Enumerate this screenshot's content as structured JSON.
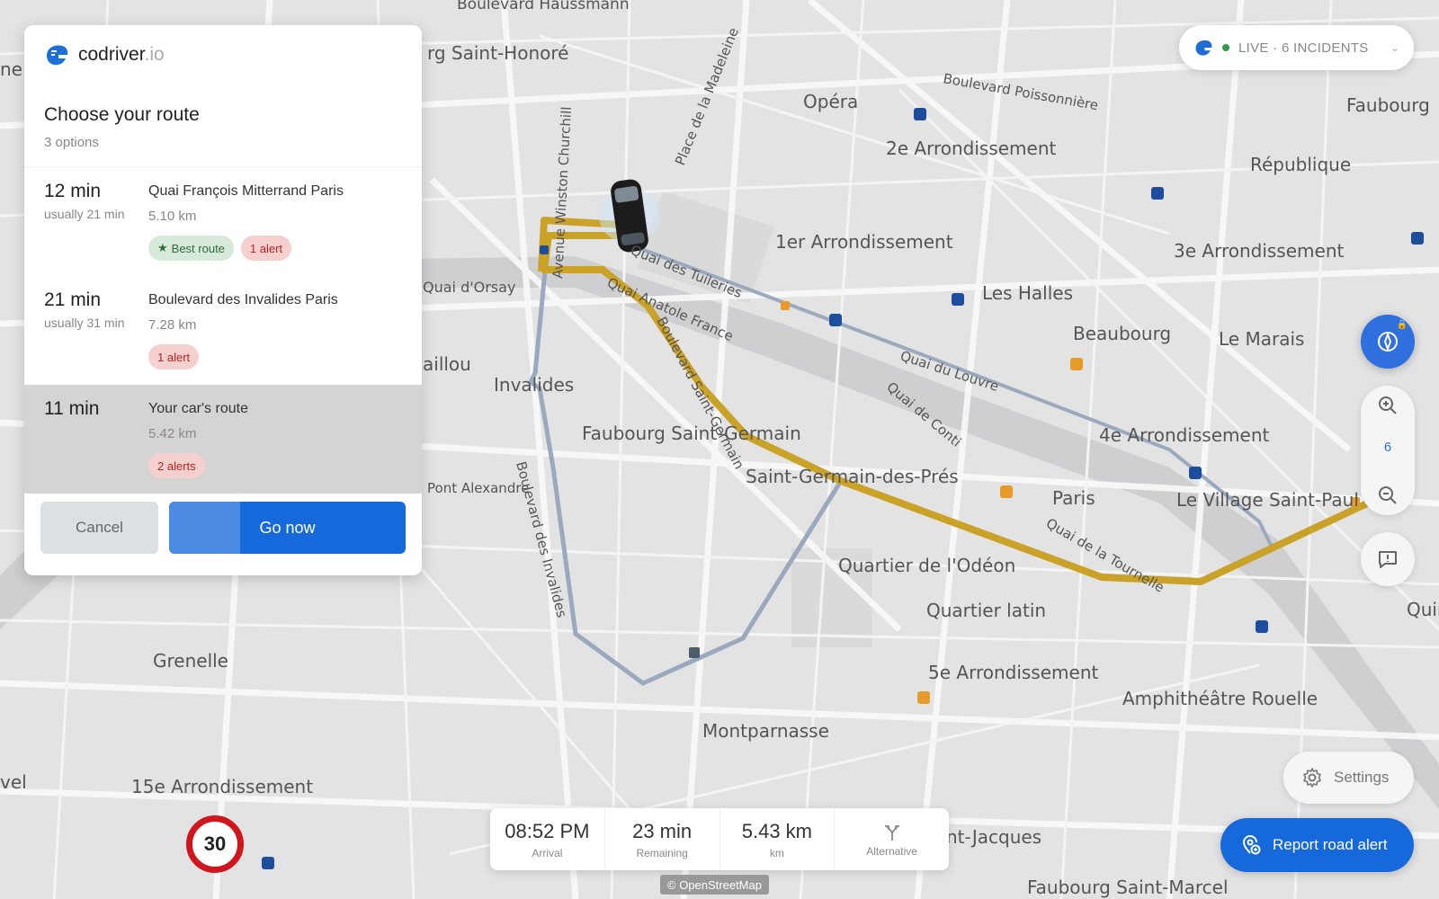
{
  "brand": {
    "name": "codriver",
    "tld": ".io"
  },
  "panel": {
    "title": "Choose your route",
    "subtitle": "3 options",
    "routes": [
      {
        "time": "12 min",
        "usual": "usually 21 min",
        "name": "Quai François Mitterrand Paris",
        "distance": "5.10 km",
        "badges": [
          {
            "label": "Best route",
            "kind": "best"
          },
          {
            "label": "1 alert",
            "kind": "alert"
          }
        ],
        "selected": false
      },
      {
        "time": "21 min",
        "usual": "usually 31 min",
        "name": "Boulevard des Invalides Paris",
        "distance": "7.28 km",
        "badges": [
          {
            "label": "1 alert",
            "kind": "alert"
          }
        ],
        "selected": false
      },
      {
        "time": "11 min",
        "usual": "",
        "name": "Your car's route",
        "distance": "5.42 km",
        "badges": [
          {
            "label": "2 alerts",
            "kind": "alert"
          }
        ],
        "selected": true
      }
    ],
    "cancel_label": "Cancel",
    "go_label": "Go now",
    "go_progress": 0.3
  },
  "live": {
    "label": "LIVE · 6 INCIDENTS"
  },
  "zoom": {
    "level": "6"
  },
  "settings_label": "Settings",
  "report_label": "Report road alert",
  "trip": {
    "arrival": {
      "value": "08:52 PM",
      "label": "Arrival"
    },
    "remaining": {
      "value": "23 min",
      "label": "Remaining"
    },
    "distance": {
      "value": "5.43 km",
      "label": "km"
    },
    "alternative_label": "Alternative"
  },
  "osm_credit": "© OpenStreetMap",
  "speed_limit": "30",
  "colors": {
    "accent": "#1669da",
    "route": "#c9a227",
    "alert": "#b3261e",
    "best": "#2f6b3b"
  },
  "map_labels": [
    "Boulevard Haussmann",
    "Opéra",
    "Boulevard Poissonnière",
    "2e Arrondissement",
    "République",
    "Faubourg",
    "1er Arrondissement",
    "Les Halles",
    "Beaubourg",
    "Le Marais",
    "3e Arrondissement",
    "Quai d'Orsay",
    "Quai des Tuileries",
    "Quai du Louvre",
    "Invalides",
    "Faubourg Saint-Germain",
    "Saint-Germain-des-Prés",
    "4e Arrondissement",
    "Paris",
    "Le Village Saint-Paul",
    "Quai de Conti",
    "Quartier de l'Odéon",
    "Quartier latin",
    "5e Arrondissement",
    "Amphithéâtre Rouelle",
    "Grenelle",
    "Montparnasse",
    "15e Arrondissement",
    "Faubourg Saint-Marcel",
    "Quai de la Tournelle",
    "Boulevard Saint-Germain",
    "Boulevard des Invalides",
    "Quai Anatole France",
    "Place de la Madeleine",
    "Avenue Winston Churchill",
    "Pont Alexandre",
    "aillou",
    "rg Saint-Honoré",
    "Quinze",
    "nt-Jacques",
    "vel",
    "ne"
  ]
}
